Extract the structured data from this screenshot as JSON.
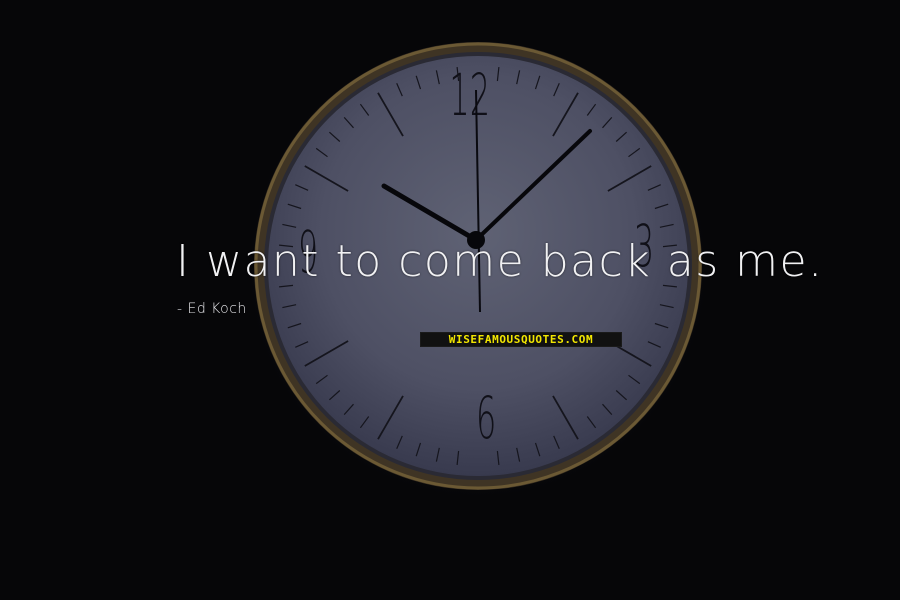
{
  "quote": {
    "text": "I want to come back as me.",
    "author": "- Ed Koch"
  },
  "watermark": {
    "text": "WISEFAMOUSQUOTES.COM",
    "color": "#f2e600"
  },
  "clock": {
    "numerals": [
      "12",
      "3",
      "6",
      "9"
    ]
  },
  "colors": {
    "background": "#060608",
    "text": "#f1f1f3",
    "clock_face": "#56586c",
    "bezel": "#5a4a2c"
  }
}
